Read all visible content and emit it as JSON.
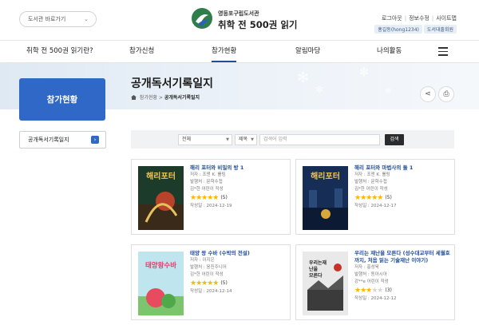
{
  "header": {
    "lib_select_label": "도서관 바로가기",
    "logo_small": "영등포구립도서관",
    "logo_big": "취학 전 500권 읽기",
    "util_links": [
      "로그아웃",
      "정보수정",
      "사이트맵"
    ],
    "user_chips": [
      "홍길동(hong1234)",
      "도서대출회원"
    ]
  },
  "nav": [
    "취학 전 500권 읽기란?",
    "참가신청",
    "참가현황",
    "알림마당",
    "나의활동"
  ],
  "side": {
    "title": "참가현황",
    "link": "공개독서기록일지"
  },
  "page": {
    "title": "공개독서기록일지",
    "breadcrumb": [
      "참가현황",
      "공개독서기록일지"
    ]
  },
  "search": {
    "scope": "전체",
    "field": "제목",
    "placeholder": "검색어 입력",
    "button": "검색"
  },
  "books": [
    {
      "title": "해리 포터와 비밀의 방 1",
      "author": "저자 : 조앤 K. 롤링",
      "publisher": "발행처 : 문학수첩",
      "writer": "김*한 어린이 작성",
      "rating": 5,
      "count": "(5)",
      "date": "작성일 : 2024-12-19"
    },
    {
      "title": "해리 포터와 마법사의 돌 1",
      "author": "저자 : 조앤 K. 롤링",
      "publisher": "발행처 : 문학수첩",
      "writer": "김*한 어린이 작성",
      "rating": 5,
      "count": "(5)",
      "date": "작성일 : 2024-12-17"
    },
    {
      "title": "태양 왕 수바 (수박의 전설)",
      "author": "저자 : 이지은",
      "publisher": "발행처 : 웅진주니어",
      "writer": "김*한 어린이 작성",
      "rating": 5,
      "count": "(5)",
      "date": "작성일 : 2024-12-14"
    },
    {
      "title": "우리는 재난을 모른다 (성수대교부터 세월호까지, 처음 읽는 기술재난 이야기)",
      "author": "저자 : 홍성욱",
      "publisher": "발행처 : 동아시아",
      "writer": "강**e 어린이 작성",
      "rating": 3,
      "count": "(3)",
      "date": "작성일 : 2024-12-12"
    }
  ],
  "covers": [
    "해리포터",
    "해리포터",
    "태양왕수바",
    "우리는재난을모른다"
  ],
  "colors": {
    "accent": "#2f68c7",
    "star": "#f6b800",
    "link": "#1e4d9c"
  }
}
